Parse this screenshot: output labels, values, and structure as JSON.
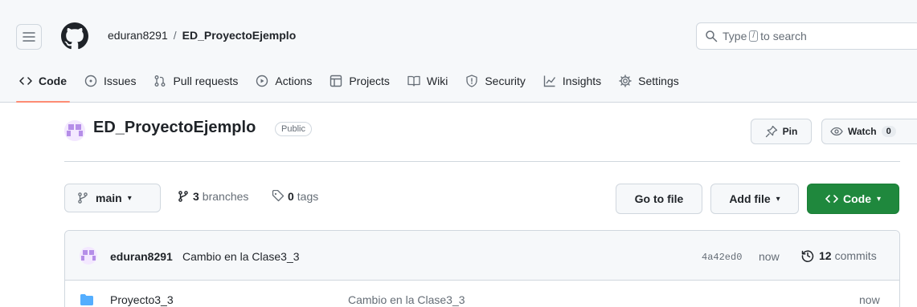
{
  "header": {
    "owner": "eduran8291",
    "separator": "/",
    "repo_name": "ED_ProyectoEjemplo",
    "search": {
      "prefix": "Type",
      "key": "/",
      "suffix": "to search"
    }
  },
  "nav": {
    "tabs": [
      {
        "label": "Code",
        "icon": "code-icon",
        "active": true
      },
      {
        "label": "Issues",
        "icon": "issue-icon"
      },
      {
        "label": "Pull requests",
        "icon": "pull-request-icon"
      },
      {
        "label": "Actions",
        "icon": "play-icon"
      },
      {
        "label": "Projects",
        "icon": "table-icon"
      },
      {
        "label": "Wiki",
        "icon": "book-icon"
      },
      {
        "label": "Security",
        "icon": "shield-icon"
      },
      {
        "label": "Insights",
        "icon": "graph-icon"
      },
      {
        "label": "Settings",
        "icon": "gear-icon"
      }
    ]
  },
  "repo": {
    "title": "ED_ProyectoEjemplo",
    "visibility": "Public",
    "pin_label": "Pin",
    "watch_label": "Watch",
    "watch_count": "0"
  },
  "branch_bar": {
    "branch": "main",
    "branches_count": "3",
    "branches_label": "branches",
    "tags_count": "0",
    "tags_label": "tags",
    "goto_label": "Go to file",
    "addfile_label": "Add file",
    "code_label": "Code"
  },
  "latest_commit": {
    "author": "eduran8291",
    "message": "Cambio en la Clase3_3",
    "sha": "4a42ed0",
    "time": "now",
    "commits_count": "12",
    "commits_label": "commits"
  },
  "files": [
    {
      "name": "Proyecto3_3",
      "message": "Cambio en la Clase3_3",
      "time": "now",
      "type": "folder"
    }
  ],
  "colors": {
    "accent_tab": "#fd8c73",
    "code_button": "#1f883d",
    "folder": "#54aeff",
    "avatar": "#b58ee8"
  }
}
